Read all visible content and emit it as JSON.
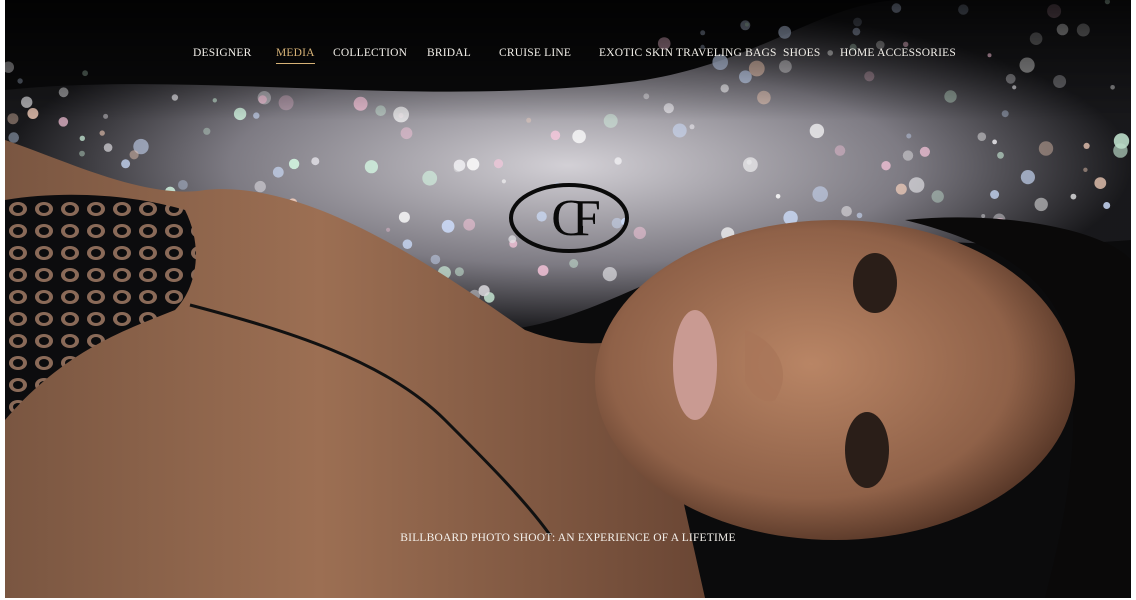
{
  "nav": {
    "items": [
      {
        "label": "DESIGNER",
        "active": false
      },
      {
        "label": "MEDIA",
        "active": true
      },
      {
        "label": "COLLECTION",
        "active": false
      },
      {
        "label": "BRIDAL",
        "active": false
      },
      {
        "label": "CRUISE LINE",
        "active": false
      },
      {
        "label": "EXOTIC SKIN TRAVELING BAGS",
        "active": false
      },
      {
        "label": "SHOES",
        "active": false
      },
      {
        "label": "HOME ACCESSORIES",
        "active": false
      }
    ]
  },
  "logo": {
    "letters": "CF"
  },
  "hero": {
    "caption": "BILLBOARD PHOTO SHOOT: AN EXPERIENCE OF A LIFETIME",
    "image": "woman-lying-on-sparkling-sequins-photo"
  },
  "colors": {
    "nav_text": "#f2efe9",
    "nav_active": "#d6b277",
    "logo": "#0a0a0a",
    "background": "#0c0b0b"
  }
}
